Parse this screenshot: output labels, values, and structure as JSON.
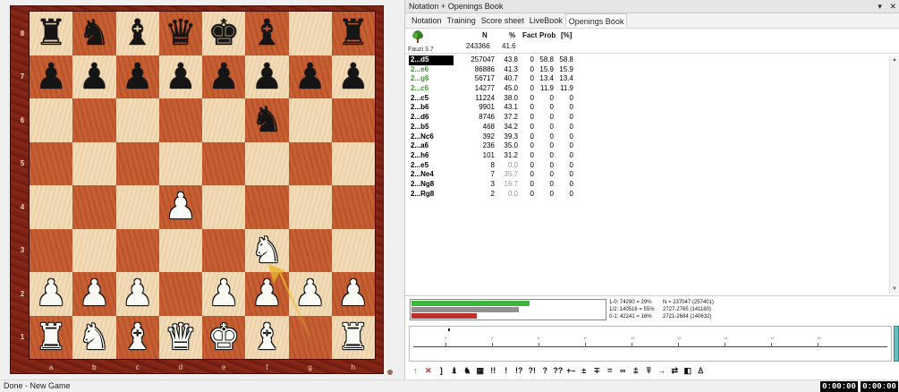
{
  "window": {
    "panel_title": "Notation + Openings Book",
    "pin_glyph": "▾",
    "close_glyph": "✕"
  },
  "tabs": [
    {
      "label": "Notation",
      "active": false
    },
    {
      "label": "Training",
      "active": false
    },
    {
      "label": "Score sheet",
      "active": false
    },
    {
      "label": "LiveBook",
      "active": false
    },
    {
      "label": "Openings Book",
      "active": true
    }
  ],
  "board": {
    "files": [
      "a",
      "b",
      "c",
      "d",
      "e",
      "f",
      "g",
      "h"
    ],
    "ranks": [
      "8",
      "7",
      "6",
      "5",
      "4",
      "3",
      "2",
      "1"
    ],
    "position": [
      [
        "br",
        "bn",
        "bb",
        "bq",
        "bk",
        "bb",
        "",
        "br"
      ],
      [
        "bp",
        "bp",
        "bp",
        "bp",
        "bp",
        "bp",
        "bp",
        "bp"
      ],
      [
        "",
        "",
        "",
        "",
        "",
        "bn",
        "",
        ""
      ],
      [
        "",
        "",
        "",
        "",
        "",
        "",
        "",
        ""
      ],
      [
        "",
        "",
        "",
        "wp",
        "",
        "",
        "",
        ""
      ],
      [
        "",
        "",
        "",
        "",
        "",
        "wn",
        "",
        ""
      ],
      [
        "wp",
        "wp",
        "wp",
        "",
        "wp",
        "wp",
        "wp",
        "wp"
      ],
      [
        "wr",
        "wn",
        "wb",
        "wq",
        "wk",
        "wb",
        "",
        "wr"
      ]
    ],
    "arrow_color": "#e8b92c"
  },
  "book": {
    "headers": {
      "n": "N",
      "pct": "%",
      "fact": "Fact",
      "prob": "Prob",
      "pct2": "[%]"
    },
    "engine_name": "Fauzi 3.7",
    "totals": {
      "n": "243366",
      "pct": "41.6"
    },
    "moves": [
      {
        "move": "2...d5",
        "n": "257047",
        "pct": "43.8",
        "fact": "0",
        "prob": "58.8",
        "pct2": "58.8",
        "style": "sel"
      },
      {
        "move": "2...e6",
        "n": "86886",
        "pct": "41.3",
        "fact": "0",
        "prob": "15.9",
        "pct2": "15.9",
        "style": "green"
      },
      {
        "move": "2...g6",
        "n": "56717",
        "pct": "40.7",
        "fact": "0",
        "prob": "13.4",
        "pct2": "13.4",
        "style": "green"
      },
      {
        "move": "2...c6",
        "n": "14277",
        "pct": "45.0",
        "fact": "0",
        "prob": "11.9",
        "pct2": "11.9",
        "style": "green"
      },
      {
        "move": "2...c5",
        "n": "11224",
        "pct": "38.0",
        "fact": "0",
        "prob": "0",
        "pct2": "0",
        "style": ""
      },
      {
        "move": "2...b6",
        "n": "9901",
        "pct": "43.1",
        "fact": "0",
        "prob": "0",
        "pct2": "0",
        "style": ""
      },
      {
        "move": "2...d6",
        "n": "8746",
        "pct": "37.2",
        "fact": "0",
        "prob": "0",
        "pct2": "0",
        "style": ""
      },
      {
        "move": "2...b5",
        "n": "468",
        "pct": "34.2",
        "fact": "0",
        "prob": "0",
        "pct2": "0",
        "style": ""
      },
      {
        "move": "2...Nc6",
        "n": "392",
        "pct": "39.3",
        "fact": "0",
        "prob": "0",
        "pct2": "0",
        "style": ""
      },
      {
        "move": "2...a6",
        "n": "236",
        "pct": "35.0",
        "fact": "0",
        "prob": "0",
        "pct2": "0",
        "style": ""
      },
      {
        "move": "2...h6",
        "n": "101",
        "pct": "31.2",
        "fact": "0",
        "prob": "0",
        "pct2": "0",
        "style": ""
      },
      {
        "move": "2...e5",
        "n": "8",
        "pct": "0.0",
        "fact": "0",
        "prob": "0",
        "pct2": "0",
        "style": "",
        "grey": true
      },
      {
        "move": "2...Ne4",
        "n": "7",
        "pct": "35.7",
        "fact": "0",
        "prob": "0",
        "pct2": "0",
        "style": "",
        "grey": true
      },
      {
        "move": "2...Ng8",
        "n": "3",
        "pct": "16.7",
        "fact": "0",
        "prob": "0",
        "pct2": "0",
        "style": "",
        "grey": true
      },
      {
        "move": "2...Rg8",
        "n": "2",
        "pct": "0.0",
        "fact": "0",
        "prob": "0",
        "pct2": "0",
        "style": "",
        "grey": true
      }
    ]
  },
  "stats": {
    "win_line": "1-0: 74290 = 29%",
    "draw_line": "1/2: 140516 = 55%",
    "loss_line": "0-1: 42241 = 16%",
    "n_line": "N = 237047 (257401)",
    "elo_line1": "2727-2765 (141180)",
    "elo_line2": "2721-2684 (140632)",
    "win_pct": 29,
    "draw_pct": 55,
    "loss_pct": 16,
    "colors": {
      "win": "#3cb53c",
      "draw": "#909090",
      "loss": "#c0302b"
    }
  },
  "timeline": {
    "ticks": [
      "2",
      "4",
      "6",
      "8",
      "10",
      "12",
      "14",
      "16",
      "18"
    ]
  },
  "symbols": [
    {
      "glyph": "↑",
      "name": "move-up-icon",
      "cls": "green"
    },
    {
      "glyph": "✕",
      "name": "delete-move-icon",
      "cls": "red"
    },
    {
      "glyph": "]",
      "name": "bracket-icon",
      "cls": ""
    },
    {
      "glyph": "♝",
      "name": "piece-bishop-icon",
      "cls": ""
    },
    {
      "glyph": "♞",
      "name": "piece-knight-icon",
      "cls": ""
    },
    {
      "glyph": "▦",
      "name": "diagram-icon",
      "cls": ""
    },
    {
      "glyph": "!!",
      "name": "annot-brilliant",
      "cls": ""
    },
    {
      "glyph": "!",
      "name": "annot-good",
      "cls": ""
    },
    {
      "glyph": "!?",
      "name": "annot-interesting",
      "cls": ""
    },
    {
      "glyph": "?!",
      "name": "annot-dubious",
      "cls": ""
    },
    {
      "glyph": "?",
      "name": "annot-mistake",
      "cls": ""
    },
    {
      "glyph": "??",
      "name": "annot-blunder",
      "cls": ""
    },
    {
      "glyph": "+–",
      "name": "eval-white-winning",
      "cls": ""
    },
    {
      "glyph": "±",
      "name": "eval-white-better",
      "cls": ""
    },
    {
      "glyph": "∓",
      "name": "eval-black-better",
      "cls": ""
    },
    {
      "glyph": "=",
      "name": "eval-equal",
      "cls": ""
    },
    {
      "glyph": "∞",
      "name": "eval-unclear",
      "cls": ""
    },
    {
      "glyph": "⩲",
      "name": "eval-slightly-better",
      "cls": ""
    },
    {
      "glyph": "⩱",
      "name": "eval-slightly-worse",
      "cls": ""
    },
    {
      "glyph": "→",
      "name": "annot-attack",
      "cls": ""
    },
    {
      "glyph": "⇄",
      "name": "annot-counterplay",
      "cls": ""
    },
    {
      "glyph": "◧",
      "name": "eraser-icon",
      "cls": ""
    },
    {
      "glyph": "♙",
      "name": "piece-pawn-icon",
      "cls": ""
    }
  ],
  "statusbar": {
    "text": "Done - New Game",
    "clock_white": "0:00:00",
    "clock_black": "0:00:00"
  }
}
